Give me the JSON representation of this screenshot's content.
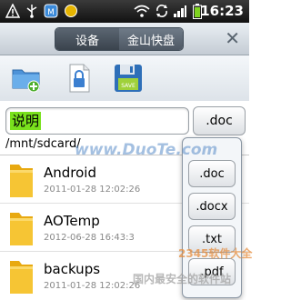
{
  "status_bar": {
    "time": "16:23",
    "icons": [
      "warning-icon",
      "usb-icon",
      "app-icon",
      "coin-icon",
      "wifi-icon",
      "sync-icon",
      "signal-icon",
      "battery-icon"
    ]
  },
  "tabs": [
    {
      "label": "设备",
      "active": true
    },
    {
      "label": "金山快盘",
      "active": false
    }
  ],
  "toolbar": {
    "buttons": [
      "new-folder-icon",
      "lock-file-icon",
      "save-icon"
    ]
  },
  "filename": {
    "value": "说明",
    "extension_label": ".doc"
  },
  "path": "/mnt/sdcard/",
  "files": [
    {
      "name": "Android",
      "date": "2011-01-28 12:02:26"
    },
    {
      "name": "AOTemp",
      "date": "2012-06-28 16:43:3"
    },
    {
      "name": "backups",
      "date": "2011-01-28 12:02:26"
    }
  ],
  "extension_options": [
    ".doc",
    ".docx",
    ".txt",
    ".pdf"
  ],
  "watermark": {
    "site": "www.DuoTe.com",
    "brand": "2345软件大全",
    "slogan": "国内最安全的软件站"
  }
}
